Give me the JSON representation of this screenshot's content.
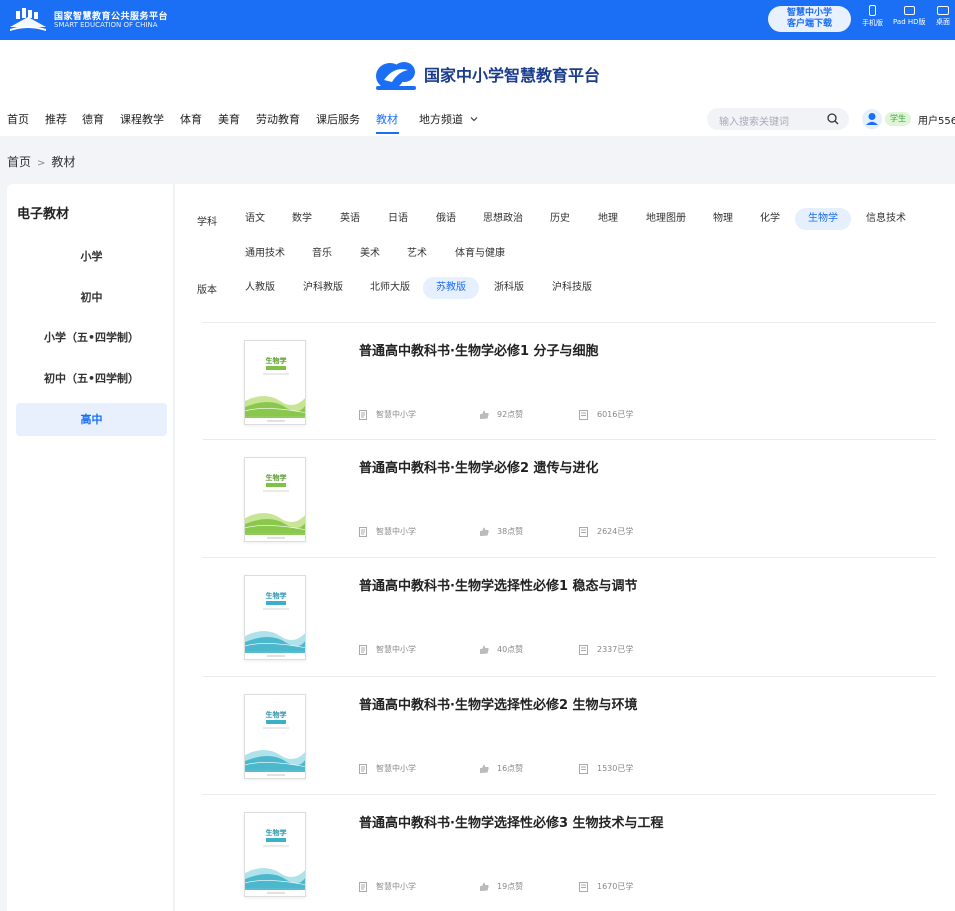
{
  "topbar": {
    "title": "国家智慧教育公共服务平台",
    "subtitle": "SMART EDUCATION OF CHINA",
    "download_line1": "智慧中小学",
    "download_line2": "客户端下载",
    "devices": [
      "手机版",
      "Pad HD版",
      "桌面"
    ]
  },
  "header": {
    "brand": "国家中小学智慧教育平台",
    "nav": [
      "首页",
      "推荐",
      "德育",
      "课程教学",
      "体育",
      "美育",
      "劳动教育",
      "课后服务",
      "教材",
      "地方频道"
    ],
    "active_nav": "教材",
    "search_placeholder": "输入搜索关键词",
    "role_badge": "学生",
    "username": "用户556"
  },
  "breadcrumb": [
    "首页",
    "教材"
  ],
  "sidebar": {
    "title": "电子教材",
    "items": [
      "小学",
      "初中",
      "小学（五•四学制）",
      "初中（五•四学制）",
      "高中"
    ],
    "active": "高中"
  },
  "filters": {
    "subject_label": "学科",
    "subjects_row1": [
      "语文",
      "数学",
      "英语",
      "日语",
      "俄语",
      "思想政治",
      "历史",
      "地理",
      "地理图册",
      "物理",
      "化学",
      "生物学",
      "信息技术"
    ],
    "subjects_row2": [
      "通用技术",
      "音乐",
      "美术",
      "艺术",
      "体育与健康"
    ],
    "active_subject": "生物学",
    "edition_label": "版本",
    "editions": [
      "人教版",
      "沪科教版",
      "北师大版",
      "苏教版",
      "浙科版",
      "沪科技版"
    ],
    "active_edition": "苏教版"
  },
  "books": [
    {
      "title": "普通高中教科书·生物学必修1 分子与细胞",
      "source": "智慧中小学",
      "likes": "92点赞",
      "learners": "6016已学",
      "cover_theme": "green",
      "cover_sub": "必修1",
      "cover_line": "分子与细胞"
    },
    {
      "title": "普通高中教科书·生物学必修2 遗传与进化",
      "source": "智慧中小学",
      "likes": "38点赞",
      "learners": "2624已学",
      "cover_theme": "green",
      "cover_sub": "必修2",
      "cover_line": "遗传与进化"
    },
    {
      "title": "普通高中教科书·生物学选择性必修1 稳态与调节",
      "source": "智慧中小学",
      "likes": "40点赞",
      "learners": "2337已学",
      "cover_theme": "blue",
      "cover_sub": "选择性必修1",
      "cover_line": "稳态与调节"
    },
    {
      "title": "普通高中教科书·生物学选择性必修2 生物与环境",
      "source": "智慧中小学",
      "likes": "16点赞",
      "learners": "1530已学",
      "cover_theme": "blue",
      "cover_sub": "选择性必修2",
      "cover_line": "生物与环境"
    },
    {
      "title": "普通高中教科书·生物学选择性必修3 生物技术与工程",
      "source": "智慧中小学",
      "likes": "19点赞",
      "learners": "1670已学",
      "cover_theme": "blue",
      "cover_sub": "选择性必修3",
      "cover_line": "生物技术与工程"
    }
  ],
  "cover_heading": "生物学",
  "colors": {
    "brand_blue": "#1b6ff5",
    "active_bg": "#e6effd",
    "badge_green": "#3aa33a"
  }
}
